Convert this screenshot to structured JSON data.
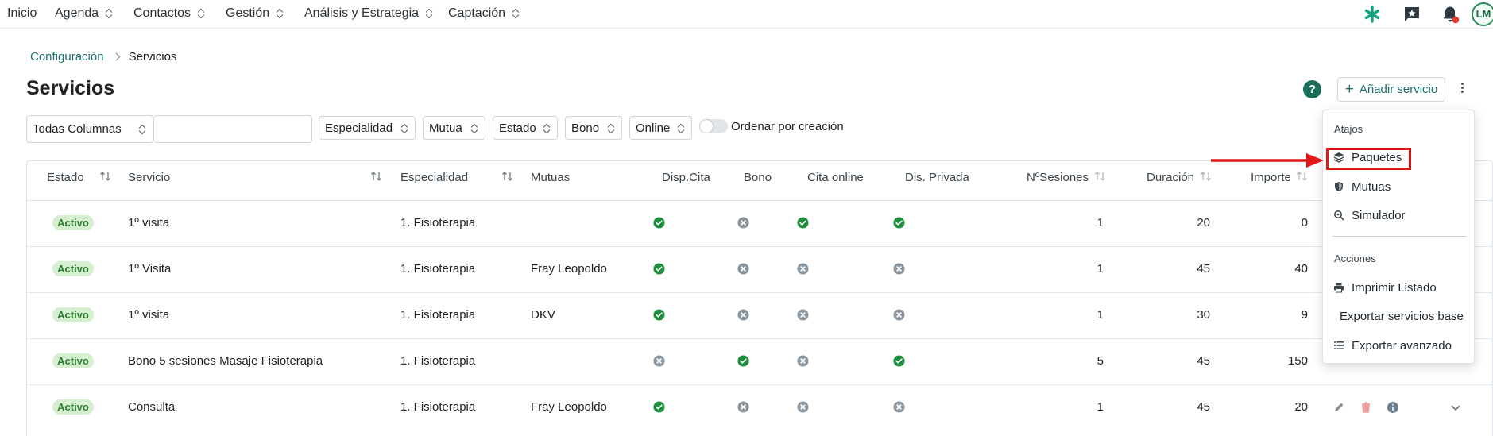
{
  "nav": {
    "items": [
      {
        "label": "Inicio",
        "has_chevron": false
      },
      {
        "label": "Agenda",
        "has_chevron": true
      },
      {
        "label": "Contactos",
        "has_chevron": true
      },
      {
        "label": "Gestión",
        "has_chevron": true
      },
      {
        "label": "Análisis y Estrategia",
        "has_chevron": true
      },
      {
        "label": "Captación",
        "has_chevron": true
      }
    ],
    "right_icons": [
      "asterisk-logo-icon",
      "star-message-icon",
      "bell-icon"
    ],
    "avatar_initials": "LM",
    "notification_color": "#e53935"
  },
  "breadcrumb": {
    "parent": "Configuración",
    "current": "Servicios"
  },
  "page": {
    "title": "Servicios"
  },
  "header_actions": {
    "help_label": "?",
    "add_label": "Añadir servicio",
    "add_icon": "+"
  },
  "filters": {
    "column_select": "Todas Columnas",
    "search_value": "",
    "dropdowns": [
      "Especialidad",
      "Mutua",
      "Estado",
      "Bono",
      "Online"
    ],
    "toggle_label": "Ordenar por creación",
    "toggle_on": false
  },
  "table": {
    "columns": [
      "Estado",
      "Servicio",
      "Especialidad",
      "Mutuas",
      "Disp.Cita",
      "Bono",
      "Cita online",
      "Dis. Privada",
      "NºSesiones",
      "Duración",
      "Importe"
    ],
    "rows": [
      {
        "estado": "Activo",
        "servicio": "1º visita",
        "especialidad": "1. Fisioterapia",
        "mutuas": "",
        "disp_cita": true,
        "bono": false,
        "cita_online": true,
        "dis_privada": true,
        "sesiones": "1",
        "duracion": "20",
        "importe": "0"
      },
      {
        "estado": "Activo",
        "servicio": "1º Visita",
        "especialidad": "1. Fisioterapia",
        "mutuas": "Fray Leopoldo",
        "disp_cita": true,
        "bono": false,
        "cita_online": false,
        "dis_privada": false,
        "sesiones": "1",
        "duracion": "45",
        "importe": "40"
      },
      {
        "estado": "Activo",
        "servicio": "1º visita",
        "especialidad": "1. Fisioterapia",
        "mutuas": "DKV",
        "disp_cita": true,
        "bono": false,
        "cita_online": false,
        "dis_privada": false,
        "sesiones": "1",
        "duracion": "30",
        "importe": "9"
      },
      {
        "estado": "Activo",
        "servicio": "Bono 5 sesiones Masaje Fisioterapia",
        "especialidad": "1. Fisioterapia",
        "mutuas": "",
        "disp_cita": false,
        "bono": true,
        "cita_online": false,
        "dis_privada": true,
        "sesiones": "5",
        "duracion": "45",
        "importe": "150"
      },
      {
        "estado": "Activo",
        "servicio": "Consulta",
        "especialidad": "1. Fisioterapia",
        "mutuas": "Fray Leopoldo",
        "disp_cita": true,
        "bono": false,
        "cita_online": false,
        "dis_privada": false,
        "sesiones": "1",
        "duracion": "45",
        "importe": "20"
      }
    ],
    "active_color": "#1e8e3e",
    "inactive_color": "#8a949c"
  },
  "menu": {
    "shortcuts_title": "Atajos",
    "shortcuts": [
      {
        "label": "Paquetes",
        "icon": "layers-icon"
      },
      {
        "label": "Mutuas",
        "icon": "shield-icon"
      },
      {
        "label": "Simulador",
        "icon": "search-settings-icon"
      }
    ],
    "actions_title": "Acciones",
    "actions": [
      {
        "label": "Imprimir Listado",
        "icon": "printer-icon"
      },
      {
        "label": "Exportar servicios base",
        "icon": ""
      },
      {
        "label": "Exportar avanzado",
        "icon": "list-icon"
      }
    ],
    "highlight_color": "#e01818"
  }
}
